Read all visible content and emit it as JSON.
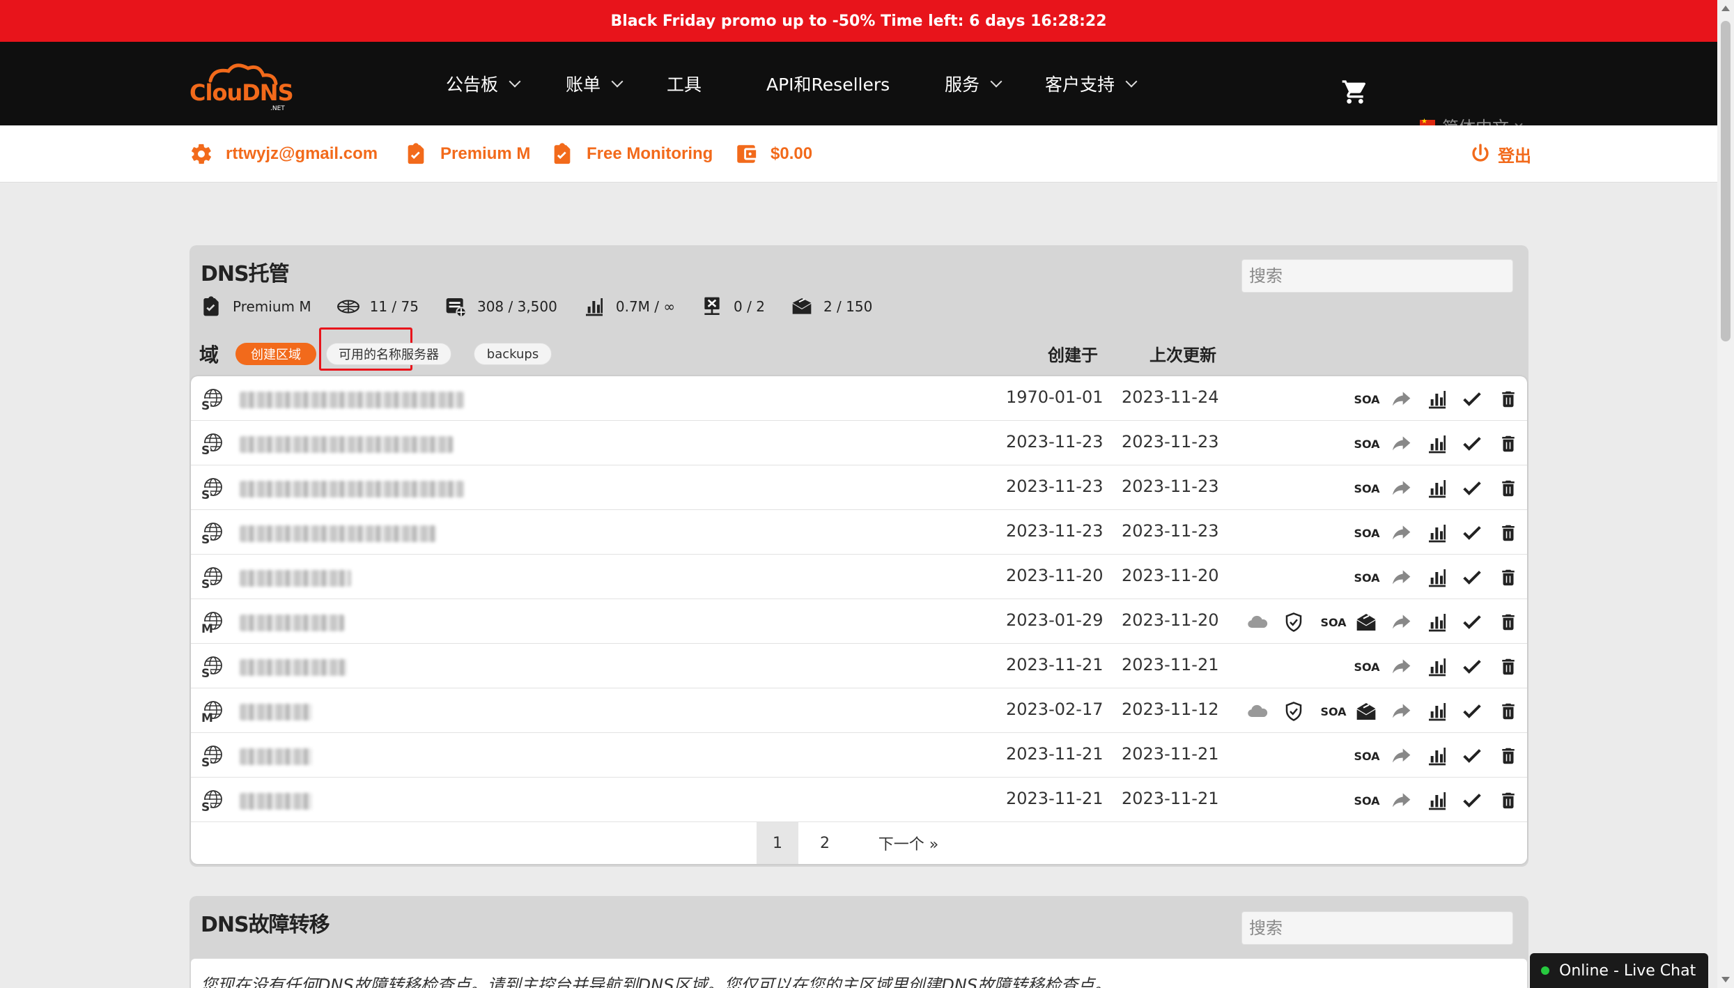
{
  "promo": {
    "text": "Black Friday promo up to -50% Time left: 6 days 16:28:22"
  },
  "brand": {
    "logo_text": "ClouDNS",
    "logo_sub": ".NET",
    "accent": "#f26a1b",
    "promo_bg": "#e8141b"
  },
  "nav": {
    "bulletin": "公告板",
    "billing": "账单",
    "tools": "工具",
    "api": "API和Resellers",
    "services": "服务",
    "support": "客户支持",
    "language": "简体中文"
  },
  "user": {
    "email": "rttwyjz@gmail.com",
    "plan": "Premium M",
    "monitoring": "Free Monitoring",
    "balance": "$0.00",
    "logout": "登出"
  },
  "dns_hosting": {
    "title": "DNS托管",
    "search_placeholder": "搜索",
    "stats": {
      "plan": "Premium M",
      "zones": "11 / 75",
      "records": "308 / 3,500",
      "queries": "0.7M / ∞",
      "failover": "0 / 2",
      "mail_forwards": "2 / 150"
    },
    "domain_label": "域",
    "create_zone": "创建区域",
    "available_ns": "可用的名称服务器",
    "backups": "backups",
    "col_created": "创建于",
    "col_updated": "上次更新",
    "soa_label": "SOA",
    "rows": [
      {
        "type": "S",
        "created": "1970-01-01",
        "updated": "2023-11-24",
        "extra": false
      },
      {
        "type": "S",
        "created": "2023-11-23",
        "updated": "2023-11-23",
        "extra": false
      },
      {
        "type": "S",
        "created": "2023-11-23",
        "updated": "2023-11-23",
        "extra": false
      },
      {
        "type": "S",
        "created": "2023-11-23",
        "updated": "2023-11-23",
        "extra": false
      },
      {
        "type": "S",
        "created": "2023-11-20",
        "updated": "2023-11-20",
        "extra": false
      },
      {
        "type": "M",
        "created": "2023-01-29",
        "updated": "2023-11-20",
        "extra": true
      },
      {
        "type": "S",
        "created": "2023-11-21",
        "updated": "2023-11-21",
        "extra": false
      },
      {
        "type": "M",
        "created": "2023-02-17",
        "updated": "2023-11-12",
        "extra": true
      },
      {
        "type": "S",
        "created": "2023-11-21",
        "updated": "2023-11-21",
        "extra": false
      },
      {
        "type": "S",
        "created": "2023-11-21",
        "updated": "2023-11-21",
        "extra": false
      }
    ],
    "pager": {
      "page1": "1",
      "page2": "2",
      "next": "下一个 »"
    }
  },
  "dns_failover": {
    "title": "DNS故障转移",
    "search_placeholder": "搜索",
    "notice": "您现在没有任何DNS故障转移检查点。请到主控台并导航到DNS区域。您仅可以在您的主区域里创建DNS故障转移检查点。"
  },
  "livechat": {
    "label": "Online - Live Chat"
  }
}
